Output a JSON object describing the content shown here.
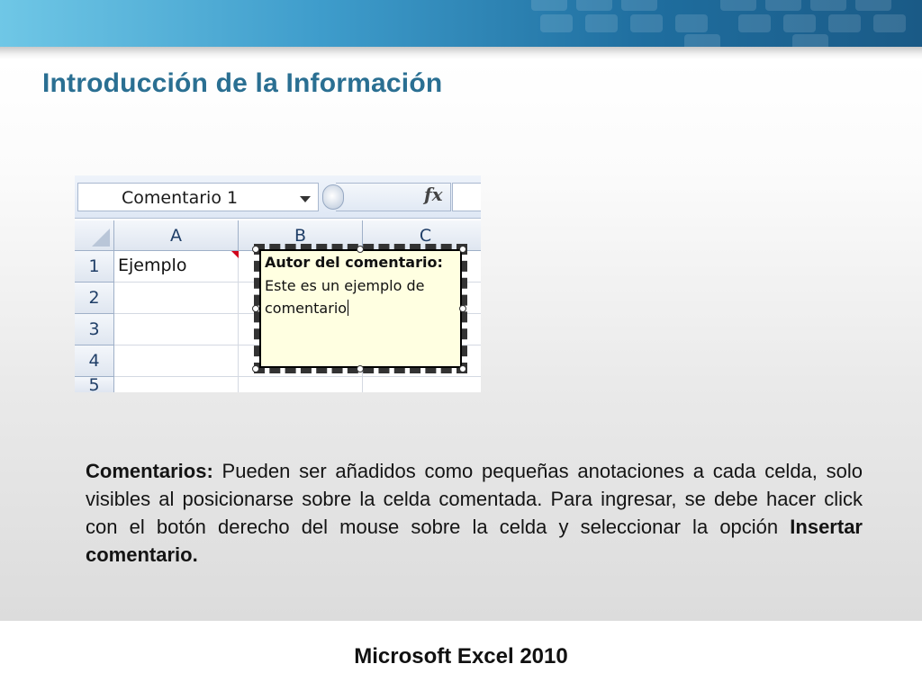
{
  "slide": {
    "title": "Introducción de la Información",
    "footer": "Microsoft Excel 2010"
  },
  "excel": {
    "name_box": "Comentario 1",
    "fx_label": "fx",
    "columns": [
      "A",
      "B",
      "C"
    ],
    "rows": [
      "1",
      "2",
      "3",
      "4",
      "5"
    ],
    "cell_a1": "Ejemplo",
    "comment": {
      "author": "Autor del comentario:",
      "line1": "Este es un ejemplo de",
      "line2": "comentario"
    }
  },
  "description": {
    "lead": "Comentarios:",
    "text": " Pueden ser añadidos como pequeñas anotaciones a cada celda, solo visibles al posicionarse sobre la celda comentada. Para ingresar, se debe hacer click con el botón derecho del mouse sobre la celda y seleccionar la opción ",
    "emphasis": "Insertar comentario."
  },
  "colors": {
    "title": "#2a6f92",
    "banner_start": "#6fc7e6",
    "banner_end": "#1a5a86",
    "comment_bg": "#ffffe1",
    "comment_flag": "#d0021b"
  }
}
